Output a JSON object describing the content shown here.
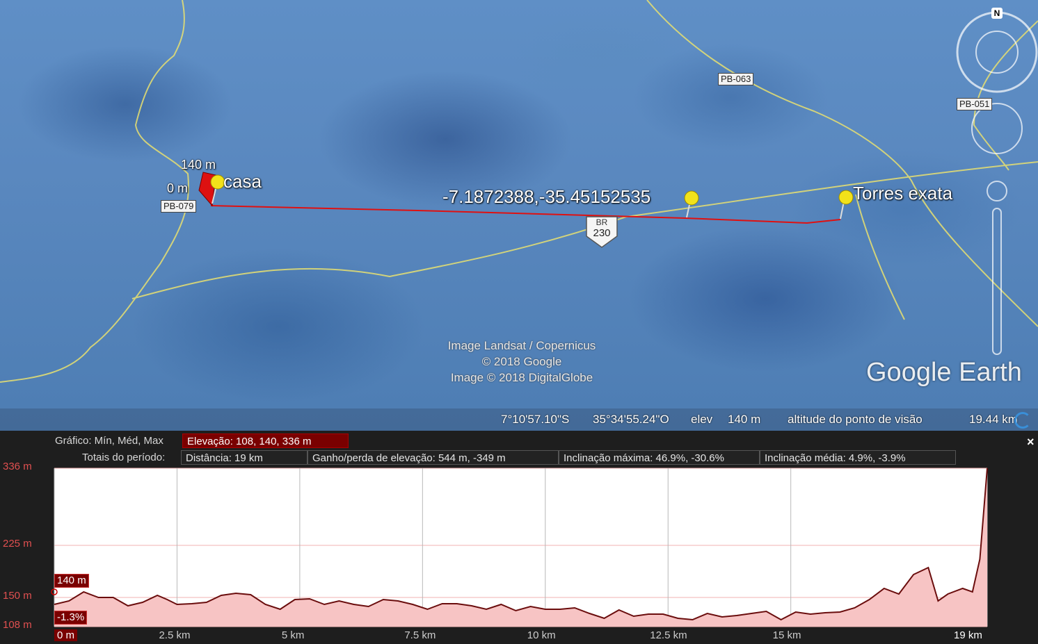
{
  "map": {
    "place_markers": [
      {
        "label": "casa"
      },
      {
        "label": "-7.1872388,-35.45152535"
      },
      {
        "label": "Torres exata"
      }
    ],
    "elevation_labels": {
      "top": "140 m",
      "bottom": "0 m"
    },
    "road_tags": [
      "PB-079",
      "PB-063",
      "PB-051"
    ],
    "br_shield": {
      "top": "BR",
      "number": "230"
    },
    "compass": {
      "north": "N"
    },
    "attribution": [
      "Image Landsat / Copernicus",
      "© 2018 Google",
      "Image © 2018 DigitalGlobe"
    ],
    "logo": "Google Earth",
    "colors": {
      "path": "#e01010",
      "road": "#e8e070",
      "pin": "#f2e21a"
    }
  },
  "status": {
    "lat": "7°10'57.10\"S",
    "lon": "35°34'55.24\"O",
    "elev_label": "elev",
    "elev_value": "140 m",
    "eye_label": "altitude do ponto de visão",
    "eye_value": "19.44 km"
  },
  "profile": {
    "graph_label": "Gráfico: Mín, Méd, Max",
    "elevation_box": "Elevação: 108, 140, 336 m",
    "totals_label": "Totais do período:",
    "distance": "Distância: 19 km",
    "gain_loss": "Ganho/perda de elevação: 544 m, -349 m",
    "max_slope": "Inclinação máxima: 46.9%, -30.6%",
    "avg_slope": "Inclinação média: 4.9%, -3.9%",
    "cursor_elev": "140 m",
    "cursor_slope": "-1.3%",
    "close": "×"
  },
  "chart_data": {
    "type": "area",
    "title": "",
    "xlabel": "",
    "ylabel": "",
    "y_tick_labels": [
      "336 m",
      "225 m",
      "150 m",
      "108 m"
    ],
    "y_ticks": [
      336,
      225,
      150,
      108
    ],
    "x_tick_labels": [
      "0 m",
      "2.5 km",
      "5 km",
      "7.5 km",
      "10 km",
      "12.5 km",
      "15 km",
      "19 km"
    ],
    "x_ticks": [
      0,
      2.5,
      5,
      7.5,
      10,
      12.5,
      15,
      19
    ],
    "xlim": [
      0,
      19
    ],
    "ylim": [
      108,
      336
    ],
    "grid": true,
    "colors": {
      "fill": "#f7c4c4",
      "line": "#6a0d0d"
    },
    "series": [
      {
        "x": [
          0,
          0.3,
          0.6,
          0.9,
          1.2,
          1.5,
          1.8,
          2.1,
          2.3,
          2.5,
          2.8,
          3.1,
          3.4,
          3.7,
          4.0,
          4.3,
          4.6,
          4.9,
          5.2,
          5.5,
          5.8,
          6.1,
          6.4,
          6.7,
          7.0,
          7.3,
          7.6,
          7.9,
          8.2,
          8.5,
          8.8,
          9.1,
          9.4,
          9.7,
          10.0,
          10.3,
          10.6,
          10.9,
          11.2,
          11.5,
          11.8,
          12.1,
          12.4,
          12.7,
          13.0,
          13.3,
          13.6,
          13.9,
          14.2,
          14.5,
          14.8,
          15.1,
          15.4,
          15.7,
          16.0,
          16.3,
          16.6,
          16.9,
          17.2,
          17.5,
          17.8,
          18.0,
          18.2,
          18.5,
          18.7,
          18.85,
          19.0
        ],
        "y": [
          140,
          145,
          158,
          150,
          150,
          138,
          143,
          153,
          147,
          140,
          141,
          143,
          153,
          156,
          154,
          140,
          133,
          147,
          148,
          140,
          145,
          140,
          137,
          147,
          145,
          140,
          133,
          141,
          141,
          138,
          133,
          140,
          131,
          137,
          133,
          133,
          135,
          127,
          120,
          132,
          123,
          126,
          126,
          120,
          118,
          127,
          122,
          124,
          127,
          130,
          118,
          129,
          126,
          128,
          129,
          135,
          147,
          163,
          155,
          183,
          193,
          145,
          155,
          163,
          158,
          205,
          336
        ]
      }
    ]
  }
}
